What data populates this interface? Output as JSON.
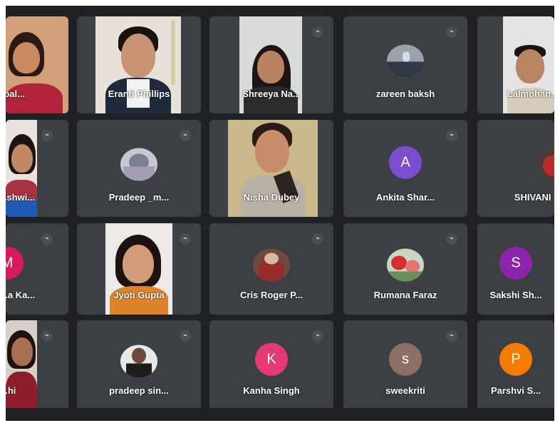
{
  "colors": {
    "background": "#202124",
    "tile": "#3c4043",
    "name_text": "#ffffff"
  },
  "participants": [
    {
      "name": "Rupal...",
      "kind": "video"
    },
    {
      "name": "Eranti Phillips",
      "kind": "video"
    },
    {
      "name": "Shreeya Na...",
      "kind": "video"
    },
    {
      "name": "zareen baksh",
      "kind": "photo"
    },
    {
      "name": "Lalmohan...",
      "kind": "video"
    },
    {
      "name": "Ashwi...",
      "kind": "video"
    },
    {
      "name": "Pradeep _m...",
      "kind": "photo"
    },
    {
      "name": "Nisha Dubey",
      "kind": "video"
    },
    {
      "name": "Ankita Shar...",
      "kind": "avatar",
      "initial": "A",
      "color": "#7b4dcf"
    },
    {
      "name": "SHIVANI ...",
      "kind": "photo"
    },
    {
      "name": "...a Ka...",
      "kind": "avatar",
      "initial": "M",
      "color": "#d81b60"
    },
    {
      "name": "Jyoti Gupta",
      "kind": "video"
    },
    {
      "name": "Cris Roger P...",
      "kind": "photo"
    },
    {
      "name": "Rumana Faraz",
      "kind": "photo"
    },
    {
      "name": "Sakshi Sh...",
      "kind": "avatar",
      "initial": "S",
      "color": "#8e24aa"
    },
    {
      "name": "...hi",
      "kind": "video"
    },
    {
      "name": "pradeep sin...",
      "kind": "photo"
    },
    {
      "name": "Kanha Singh",
      "kind": "avatar",
      "initial": "K",
      "color": "#e53973"
    },
    {
      "name": "sweekriti",
      "kind": "avatar",
      "initial": "s",
      "color": "#8d6e63"
    },
    {
      "name": "Parshvi S...",
      "kind": "avatar",
      "initial": "P",
      "color": "#f57c00"
    }
  ]
}
